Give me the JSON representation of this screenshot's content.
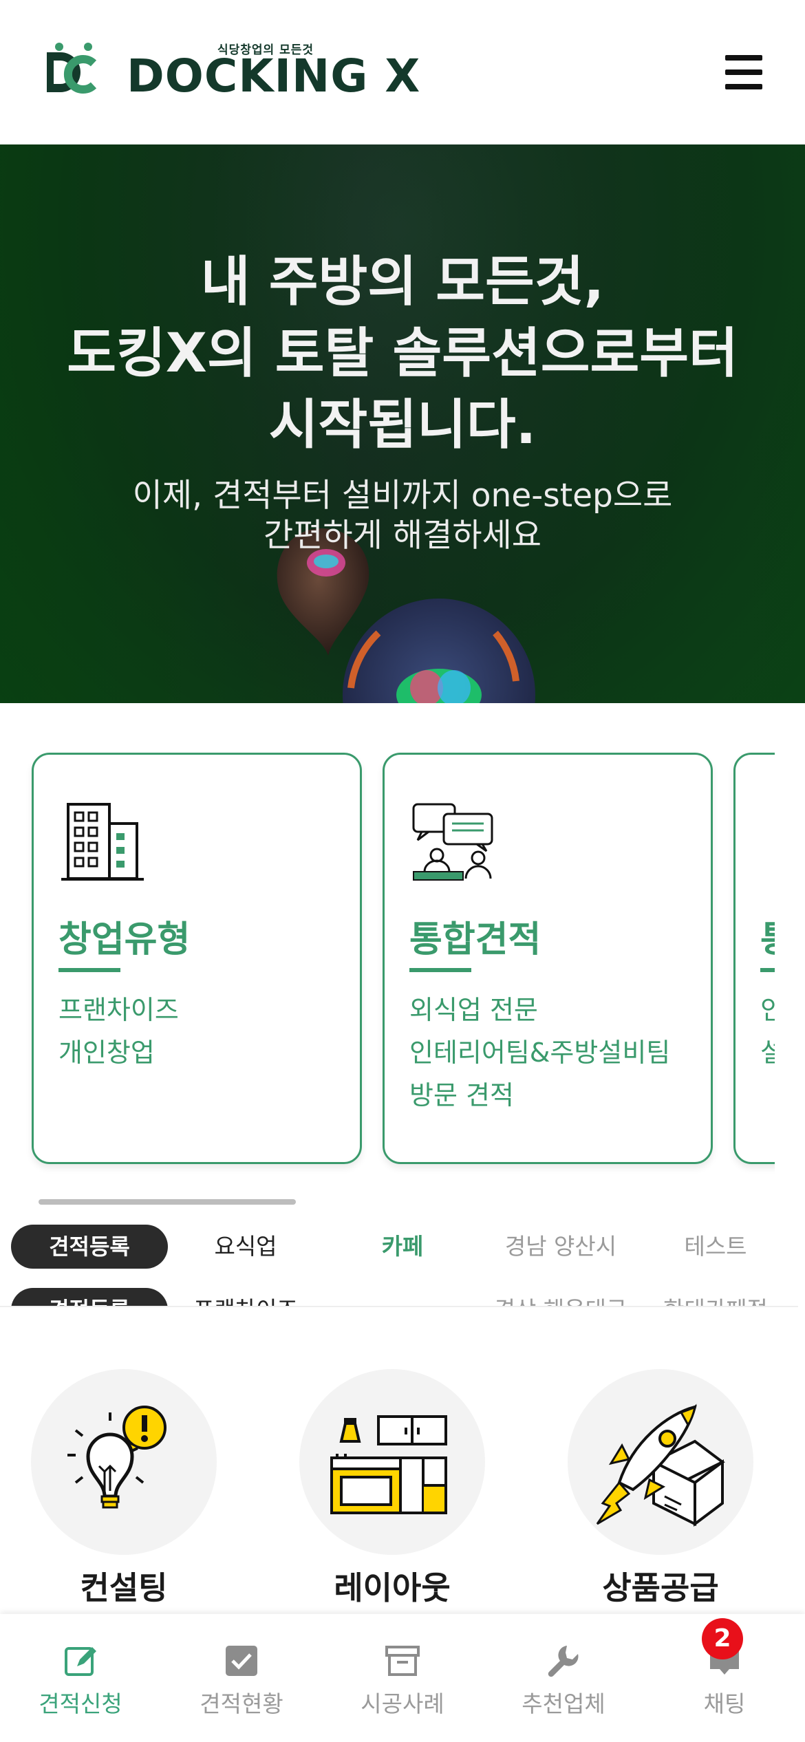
{
  "header": {
    "logo_tagline": "식당창업의 모든것",
    "logo_text": "DOCKING X",
    "menu_icon": "hamburger-menu-icon"
  },
  "hero": {
    "title_lines": [
      "내 주방의 모든것,",
      "도킹X의 토탈 솔루션으로부터",
      "시작됩니다."
    ],
    "subtitle_lines": [
      "이제, 견적부터 설비까지 one-step으로",
      "간편하게 해결하세요"
    ]
  },
  "cards": [
    {
      "icon": "building-icon",
      "title": "창업유형",
      "lines": [
        "프랜차이즈",
        "개인창업"
      ]
    },
    {
      "icon": "consultation-icon",
      "title": "통합견적",
      "lines": [
        "외식업 전문",
        "인테리어팀&주방설비팀",
        "방문 견적"
      ]
    },
    {
      "icon": "document-icon",
      "title": "통",
      "lines": [
        "인",
        "설"
      ]
    }
  ],
  "ticker": {
    "rows": [
      {
        "badge": "견적등록",
        "cells": [
          "요식업",
          "카페",
          "경남 양산시",
          "테스트"
        ]
      },
      {
        "badge": "견적등록",
        "cells": [
          "프랜차이즈",
          "",
          "경상 해운대구",
          "한대카페점"
        ]
      }
    ],
    "colors": {
      "default": "#222222",
      "accent": "#3a9a6c",
      "muted": "#9a9a9a"
    }
  },
  "services": [
    {
      "icon": "lightbulb-icon",
      "label": "컨설팅"
    },
    {
      "icon": "kitchen-layout-icon",
      "label": "레이아웃"
    },
    {
      "icon": "rocket-box-icon",
      "label": "상품공급"
    }
  ],
  "bottom_nav": {
    "items": [
      {
        "icon": "edit-icon",
        "label": "견적신청",
        "active": true
      },
      {
        "icon": "checkbox-icon",
        "label": "견적현황",
        "active": false
      },
      {
        "icon": "archive-icon",
        "label": "시공사례",
        "active": false
      },
      {
        "icon": "wrench-icon",
        "label": "추천업체",
        "active": false
      },
      {
        "icon": "chat-icon",
        "label": "채팅",
        "active": false
      }
    ],
    "chat_badge": "2"
  },
  "colors": {
    "brand_dark": "#14392b",
    "brand_green": "#3a9a6c",
    "badge_red": "#e8101a"
  }
}
